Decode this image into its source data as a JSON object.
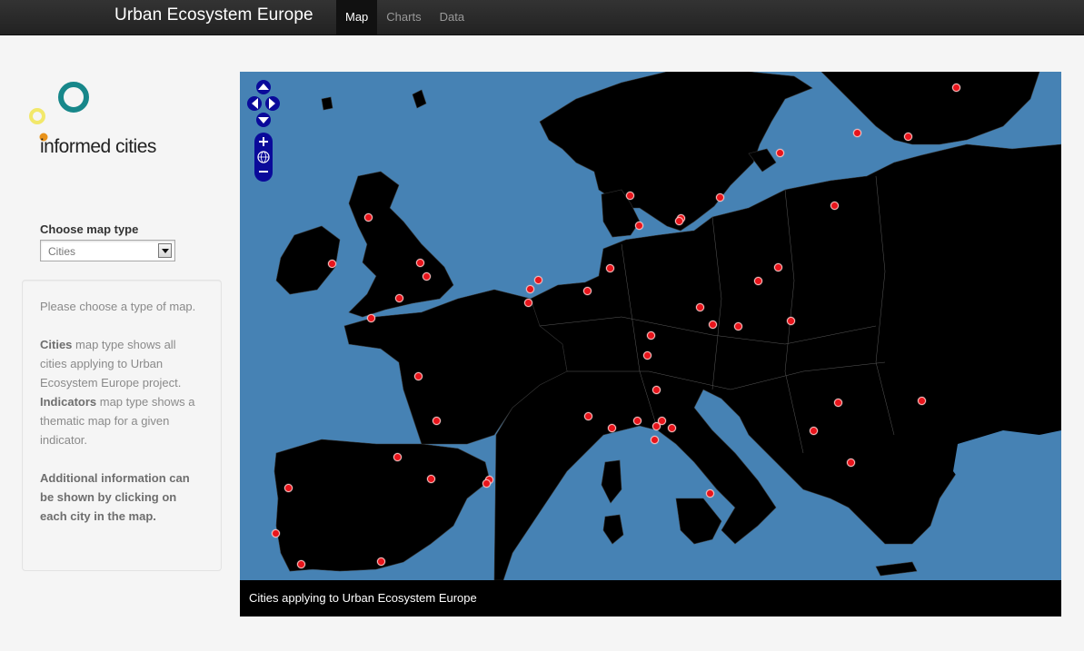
{
  "navbar": {
    "brand": "Urban Ecosystem Europe",
    "items": [
      {
        "label": "Map",
        "active": true
      },
      {
        "label": "Charts",
        "active": false
      },
      {
        "label": "Data",
        "active": false
      }
    ]
  },
  "logo": {
    "text": "informed cities"
  },
  "sidebar": {
    "choose_label": "Choose map type",
    "select_value": "Cities",
    "info": {
      "intro": "Please choose a type of map.",
      "cities_term": "Cities",
      "cities_desc": " map type shows all cities applying to Urban Ecosystem Europe project.",
      "indicators_term": "Indicators",
      "indicators_desc": " map type shows a thematic map for a given indicator.",
      "additional": "Additional information can be shown by clicking on each city in the map."
    }
  },
  "map": {
    "caption": "Cities applying to Urban Ecosystem Europe",
    "colors": {
      "sea": "#4682b4",
      "land": "#000000",
      "city": "#e8141b"
    }
  }
}
